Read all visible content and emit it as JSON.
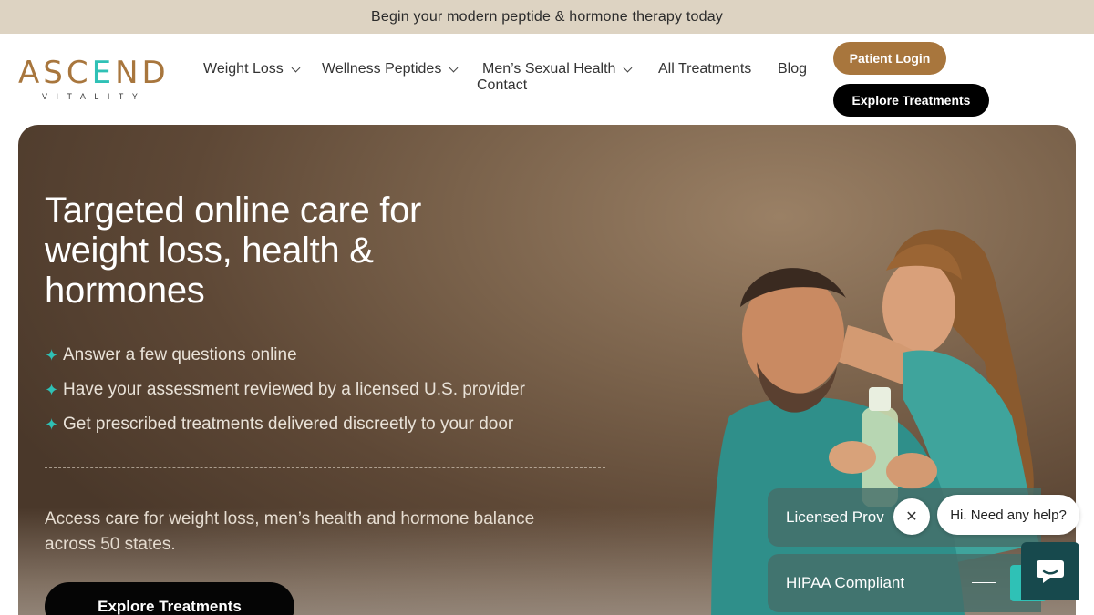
{
  "announcement": "Begin your modern peptide & hormone therapy today",
  "logo": {
    "word_a": "ASC",
    "word_e": "E",
    "word_b": "ND",
    "sub": "VITALITY"
  },
  "nav": {
    "weight_loss": "Weight Loss",
    "wellness_peptides": "Wellness Peptides",
    "mens_sexual_health": "Men’s Sexual Health",
    "all_treatments": "All Treatments",
    "blog": "Blog",
    "contact": "Contact"
  },
  "header_buttons": {
    "login": "Patient Login",
    "explore": "Explore Treatments"
  },
  "hero": {
    "title": "Targeted online care for weight loss, health & hormones",
    "bullets": [
      "Answer a few questions online",
      "Have your assessment reviewed by a licensed U.S. provider",
      "Get prescribed treatments delivered discreetly to your door"
    ],
    "subtitle": "Access care for weight loss, men’s health and hormone balance across 50 states.",
    "cta": "Explore Treatments"
  },
  "badges": {
    "licensed": "Licensed Prov",
    "hipaa": "HIPAA Compliant"
  },
  "chat": {
    "message": "Hi. Need any help?"
  },
  "colors": {
    "brand_gold": "#a8763d",
    "brand_teal": "#2fc1b6",
    "announce_bg": "#ddd3c2",
    "chat_bg": "#17494d"
  },
  "icons": {
    "bullet": "sparkle-icon",
    "chevron": "chevron-down-icon",
    "close": "close-icon",
    "chat": "chat-icon"
  }
}
